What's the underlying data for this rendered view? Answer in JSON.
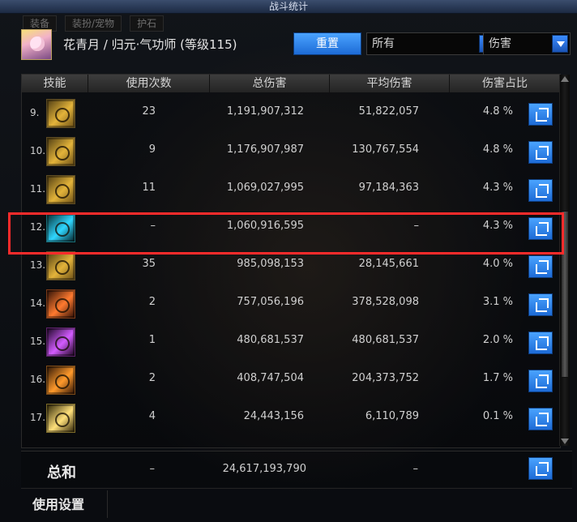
{
  "window": {
    "title": "战斗统计"
  },
  "background_tabs": [
    "装备",
    "装扮/宠物",
    "护石"
  ],
  "header": {
    "character_label": "花青月 / 归元·气功师 (等级115)",
    "reset_label": "重置",
    "filter_select": {
      "selected": "所有"
    },
    "metric_select": {
      "selected": "伤害"
    }
  },
  "table": {
    "columns": [
      "技能",
      "使用次数",
      "总伤害",
      "平均伤害",
      "伤害占比"
    ],
    "rows": [
      {
        "index": "9.",
        "count": "23",
        "total": "1,191,907,312",
        "avg": "51,822,057",
        "ratio": "4.8 %"
      },
      {
        "index": "10.",
        "count": "9",
        "total": "1,176,907,987",
        "avg": "130,767,554",
        "ratio": "4.8 %"
      },
      {
        "index": "11.",
        "count": "11",
        "total": "1,069,027,995",
        "avg": "97,184,363",
        "ratio": "4.3 %"
      },
      {
        "index": "12.",
        "count": "–",
        "total": "1,060,916,595",
        "avg": "–",
        "ratio": "4.3 %"
      },
      {
        "index": "13.",
        "count": "35",
        "total": "985,098,153",
        "avg": "28,145,661",
        "ratio": "4.0 %"
      },
      {
        "index": "14.",
        "count": "2",
        "total": "757,056,196",
        "avg": "378,528,098",
        "ratio": "3.1 %"
      },
      {
        "index": "15.",
        "count": "1",
        "total": "480,681,537",
        "avg": "480,681,537",
        "ratio": "2.0 %"
      },
      {
        "index": "16.",
        "count": "2",
        "total": "408,747,504",
        "avg": "204,373,752",
        "ratio": "1.7 %"
      },
      {
        "index": "17.",
        "count": "4",
        "total": "24,443,156",
        "avg": "6,110,789",
        "ratio": "0.1 %"
      }
    ]
  },
  "summary": {
    "label": "总和",
    "count": "–",
    "total": "24,617,193,790",
    "avg": "–"
  },
  "footer": {
    "settings_label": "使用设置"
  },
  "icons": {
    "share": "share-icon",
    "dropdown": "chevron-down-icon",
    "skill": "skill-icon",
    "avatar": "avatar"
  },
  "colors": {
    "accent_blue": "#1d6bd6",
    "highlight_red": "#ff2b2b"
  }
}
